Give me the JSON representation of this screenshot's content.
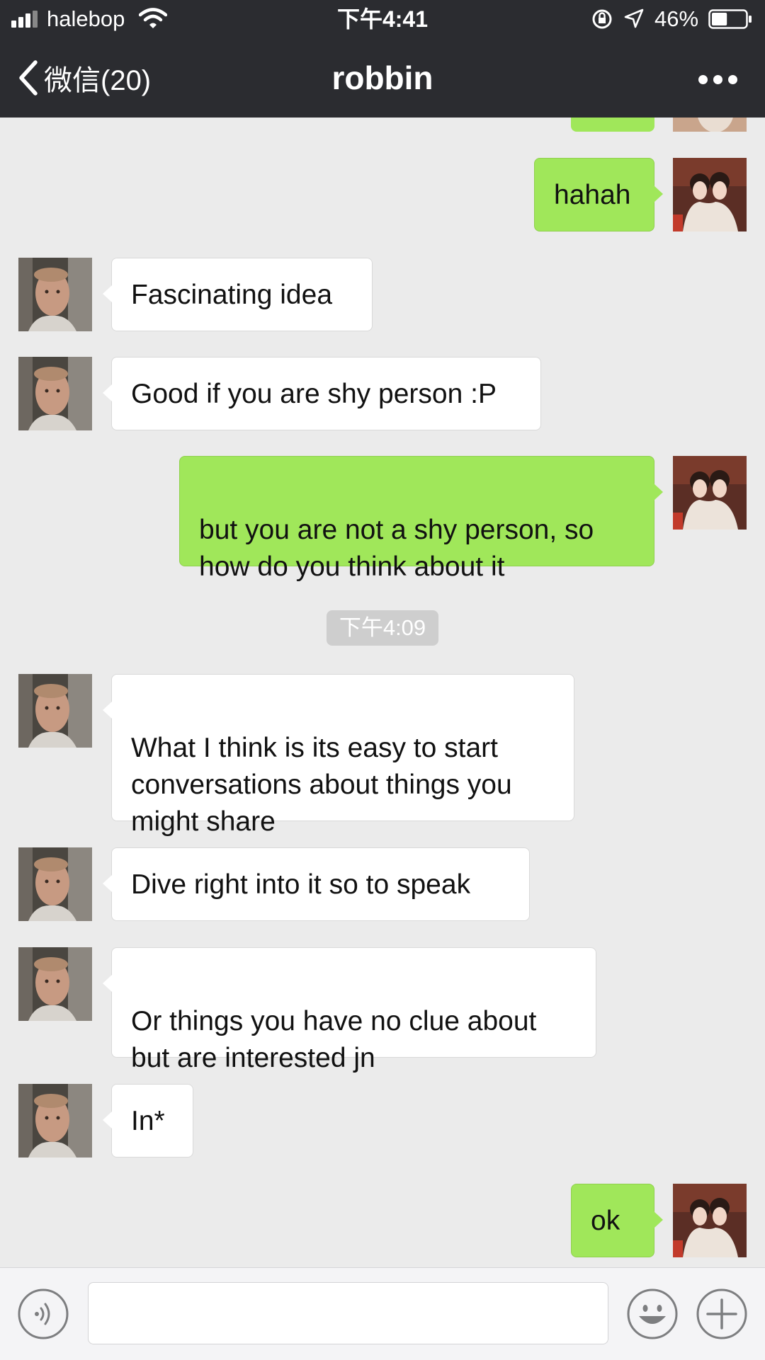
{
  "status_bar": {
    "carrier": "halebop",
    "time": "下午4:41",
    "battery": "46%",
    "battery_level": 0.46
  },
  "nav": {
    "back_label": "微信(20)",
    "title": "robbin",
    "more_icon": "more-dots-icon"
  },
  "chat": {
    "timestamp": "下午4:09",
    "messages": [
      {
        "side": "out",
        "text": "hahah"
      },
      {
        "side": "in",
        "text": "Fascinating idea"
      },
      {
        "side": "in",
        "text": "Good if you are shy person :P"
      },
      {
        "side": "out",
        "text": "but you are not a shy person, so\nhow do you think about it"
      },
      {
        "side": "in",
        "text": "What I think is its easy to start\nconversations about things you\nmight share"
      },
      {
        "side": "in",
        "text": "Dive right into it so to speak"
      },
      {
        "side": "in",
        "text": "Or things you have no clue about\nbut are interested jn"
      },
      {
        "side": "in",
        "text": "In*"
      },
      {
        "side": "out",
        "text": "ok"
      }
    ]
  },
  "input_bar": {
    "voice_icon": "voice-icon",
    "text_value": "",
    "emoji_icon": "emoji-icon",
    "plus_icon": "plus-icon"
  },
  "colors": {
    "header_bg": "#2b2c30",
    "chat_bg": "#ebebeb",
    "outgoing_bubble": "#a0e75a",
    "incoming_bubble": "#ffffff"
  }
}
